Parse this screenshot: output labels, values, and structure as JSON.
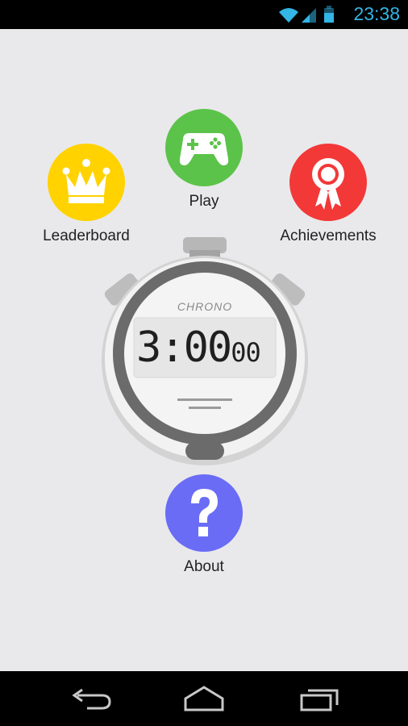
{
  "status_bar": {
    "time": "23:38",
    "icons": [
      "wifi-icon",
      "signal-icon",
      "battery-icon"
    ],
    "accent_color": "#33b5e5"
  },
  "menu": {
    "play": {
      "label": "Play",
      "color": "#5cc34a",
      "icon": "gamepad-icon"
    },
    "leaderboard": {
      "label": "Leaderboard",
      "color": "#ffd200",
      "icon": "crown-icon"
    },
    "achievements": {
      "label": "Achievements",
      "color": "#f33838",
      "icon": "ribbon-icon"
    },
    "about": {
      "label": "About",
      "color": "#6a6cf6",
      "icon": "question-icon"
    }
  },
  "stopwatch": {
    "brand": "CHRONO",
    "time_main": "3:00",
    "time_centiseconds": "00"
  },
  "nav_bar": {
    "icons": [
      "back-icon",
      "home-icon",
      "recent-apps-icon"
    ]
  }
}
